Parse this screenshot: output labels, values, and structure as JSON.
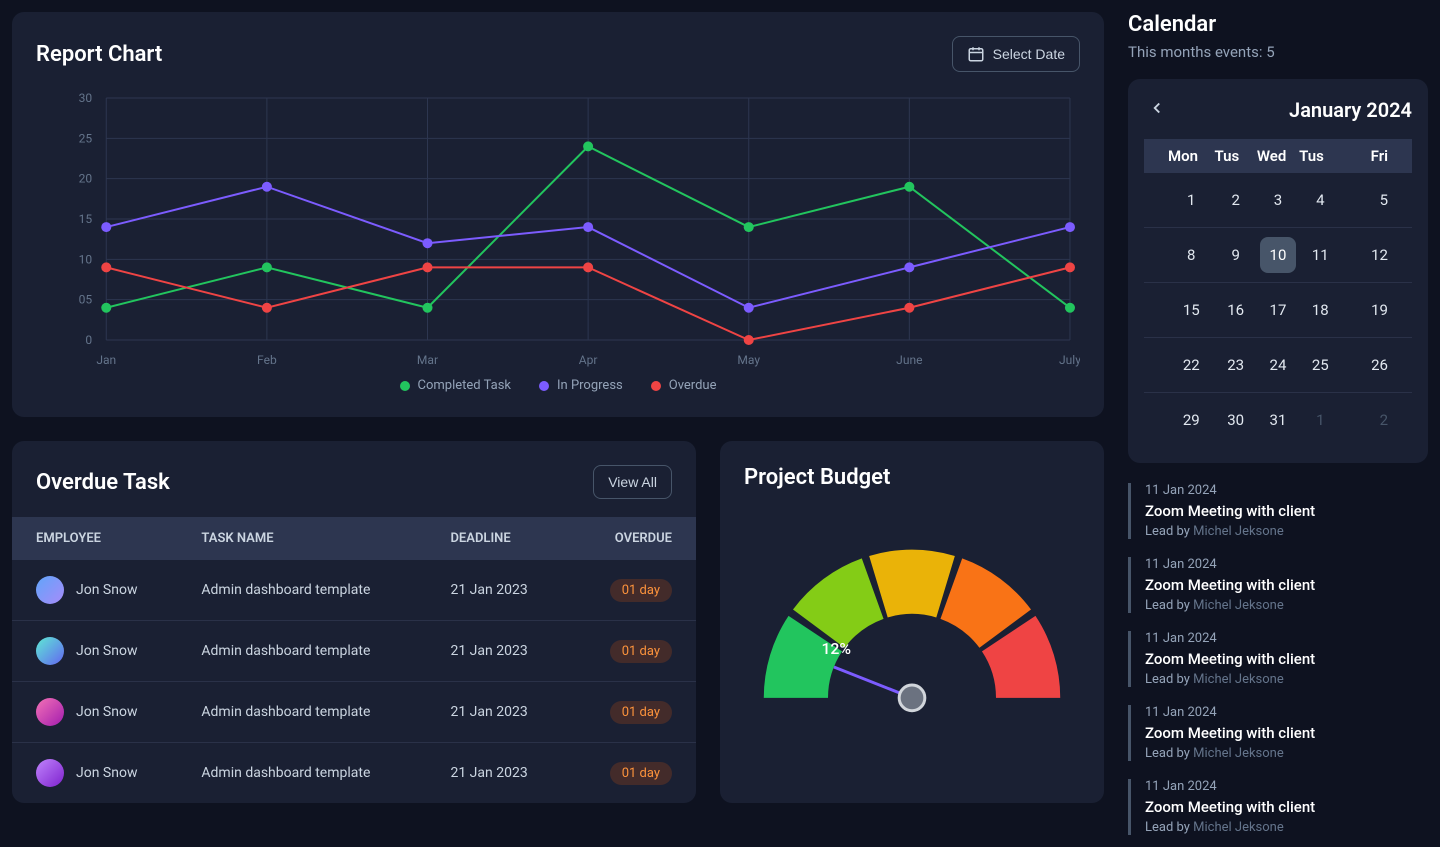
{
  "report": {
    "title": "Report Chart",
    "select_date_label": "Select Date"
  },
  "chart_data": {
    "type": "line",
    "categories": [
      "Jan",
      "Feb",
      "Mar",
      "Apr",
      "May",
      "June",
      "July"
    ],
    "y_ticks": [
      "0",
      "05",
      "10",
      "15",
      "20",
      "25",
      "30"
    ],
    "ylim": [
      0,
      30
    ],
    "series": [
      {
        "name": "Completed Task",
        "color": "#22c55e",
        "values": [
          4,
          9,
          4,
          24,
          14,
          19,
          4
        ]
      },
      {
        "name": "In Progress",
        "color": "#7c5cff",
        "values": [
          14,
          19,
          12,
          14,
          4,
          9,
          14
        ]
      },
      {
        "name": "Overdue",
        "color": "#ef4444",
        "values": [
          9,
          4,
          9,
          9,
          0,
          4,
          9
        ]
      }
    ]
  },
  "overdue": {
    "title": "Overdue Task",
    "view_all_label": "View All",
    "columns": [
      "EMPLOYEE",
      "TASK NAME",
      "DEADLINE",
      "OVERDUE"
    ],
    "rows": [
      {
        "employee": "Jon Snow",
        "task": "Admin dashboard template",
        "deadline": "21 Jan 2023",
        "overdue": "01 day",
        "avatar_colors": [
          "#60a5fa",
          "#a78bfa"
        ]
      },
      {
        "employee": "Jon Snow",
        "task": "Admin dashboard template",
        "deadline": "21 Jan 2023",
        "overdue": "01 day",
        "avatar_colors": [
          "#5eead4",
          "#6366f1"
        ]
      },
      {
        "employee": "Jon Snow",
        "task": "Admin dashboard template",
        "deadline": "21 Jan 2023",
        "overdue": "01 day",
        "avatar_colors": [
          "#f472b6",
          "#a21caf"
        ]
      },
      {
        "employee": "Jon Snow",
        "task": "Admin dashboard template",
        "deadline": "21 Jan 2023",
        "overdue": "01 day",
        "avatar_colors": [
          "#c084fc",
          "#7e22ce"
        ]
      }
    ]
  },
  "budget": {
    "title": "Project Budget",
    "percent_label": "12%",
    "percent_value": 12,
    "segments": [
      {
        "color": "#22c55e"
      },
      {
        "color": "#84cc16"
      },
      {
        "color": "#eab308"
      },
      {
        "color": "#f97316"
      },
      {
        "color": "#ef4444"
      }
    ]
  },
  "calendar": {
    "title": "Calendar",
    "subtitle_prefix": "This months events: ",
    "events_count": "5",
    "month_label": "January 2024",
    "day_headers": [
      "Mon",
      "Tus",
      "Wed",
      "Tus",
      "Fri"
    ],
    "weeks": [
      [
        "1",
        "2",
        "3",
        "4",
        "5"
      ],
      [
        "8",
        "9",
        "10",
        "11",
        "12"
      ],
      [
        "15",
        "16",
        "17",
        "18",
        "19"
      ],
      [
        "22",
        "23",
        "24",
        "25",
        "26"
      ],
      [
        "29",
        "30",
        "31",
        "1",
        "2"
      ]
    ],
    "active_day": "10",
    "dim_days": [
      "1",
      "2"
    ],
    "dim_row_index": 4,
    "events": [
      {
        "date": "11 Jan 2024",
        "title": "Zoom Meeting with client",
        "lead_label": "Lead by ",
        "lead_name": "Michel Jeksone"
      },
      {
        "date": "11 Jan 2024",
        "title": "Zoom Meeting with client",
        "lead_label": "Lead by ",
        "lead_name": "Michel Jeksone"
      },
      {
        "date": "11 Jan 2024",
        "title": "Zoom Meeting with client",
        "lead_label": "Lead by ",
        "lead_name": "Michel Jeksone"
      },
      {
        "date": "11 Jan 2024",
        "title": "Zoom Meeting with client",
        "lead_label": "Lead by ",
        "lead_name": "Michel Jeksone"
      },
      {
        "date": "11 Jan 2024",
        "title": "Zoom Meeting with client",
        "lead_label": "Lead by ",
        "lead_name": "Michel Jeksone"
      }
    ]
  }
}
